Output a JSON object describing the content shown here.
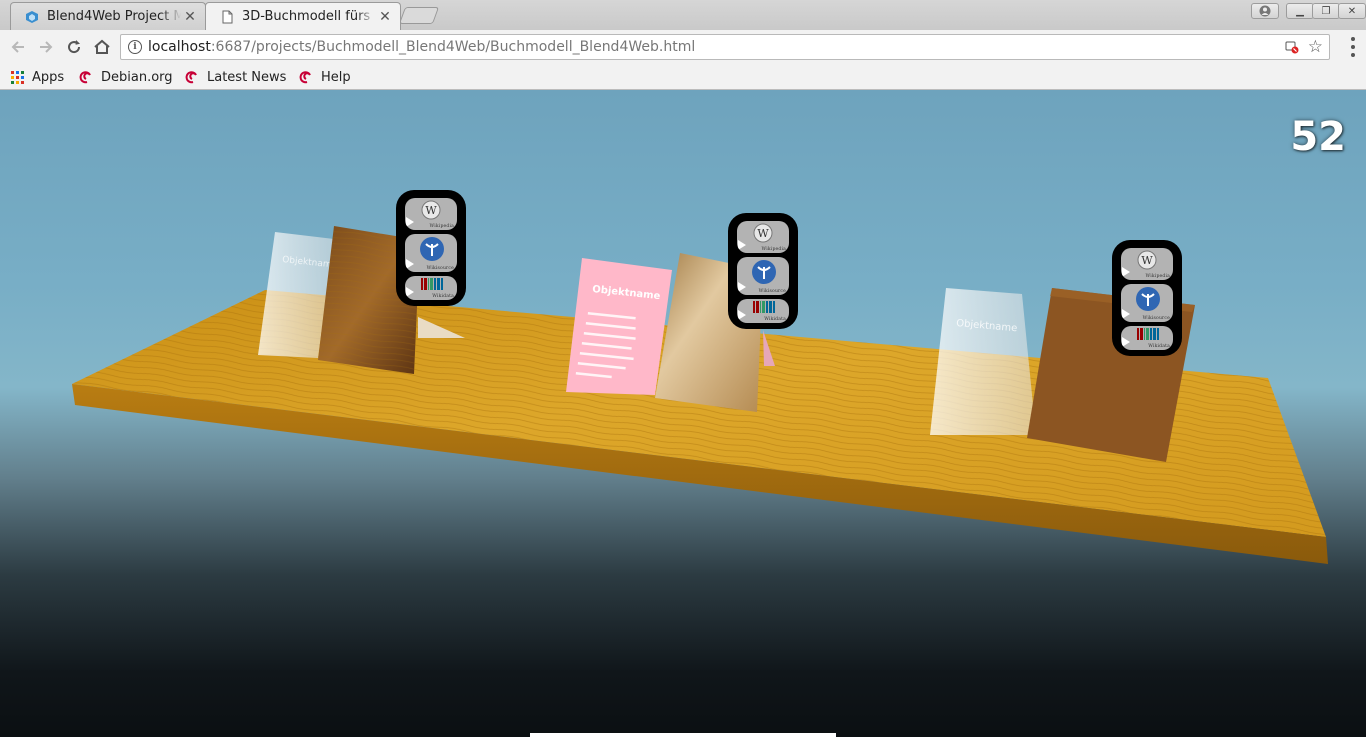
{
  "browser": {
    "tabs": [
      {
        "title": "Blend4Web Project M",
        "favicon": "blend4web-icon",
        "active": false
      },
      {
        "title": "3D-Buchmodell fürs",
        "favicon": "page-icon",
        "active": true
      }
    ],
    "url_host": "localhost",
    "url_rest": ":6687/projects/Buchmodell_Blend4Web/Buchmodell_Blend4Web.html",
    "bookmarks": [
      {
        "label": "Apps",
        "icon": "apps-grid-icon"
      },
      {
        "label": "Debian.org",
        "icon": "debian-icon"
      },
      {
        "label": "Latest News",
        "icon": "debian-icon"
      },
      {
        "label": "Help",
        "icon": "debian-icon"
      }
    ]
  },
  "scene": {
    "fps_counter": "52",
    "card_title": "Objektname",
    "icon_panel_buttons": [
      {
        "icon": "wikipedia-icon",
        "caption": "Wikipedia"
      },
      {
        "icon": "wikisource-icon",
        "caption": "Wikisource"
      },
      {
        "icon": "wikidata-icon",
        "caption": "Wikidata"
      }
    ],
    "colors": {
      "shelf_wood": "#d49a18",
      "book_dark_wood": "#8a5220",
      "book_parchment": "#c8a56c",
      "book_brown": "#8c5522",
      "pink_card": "#ffb6c8",
      "sky_top": "#6ea3bd"
    }
  }
}
